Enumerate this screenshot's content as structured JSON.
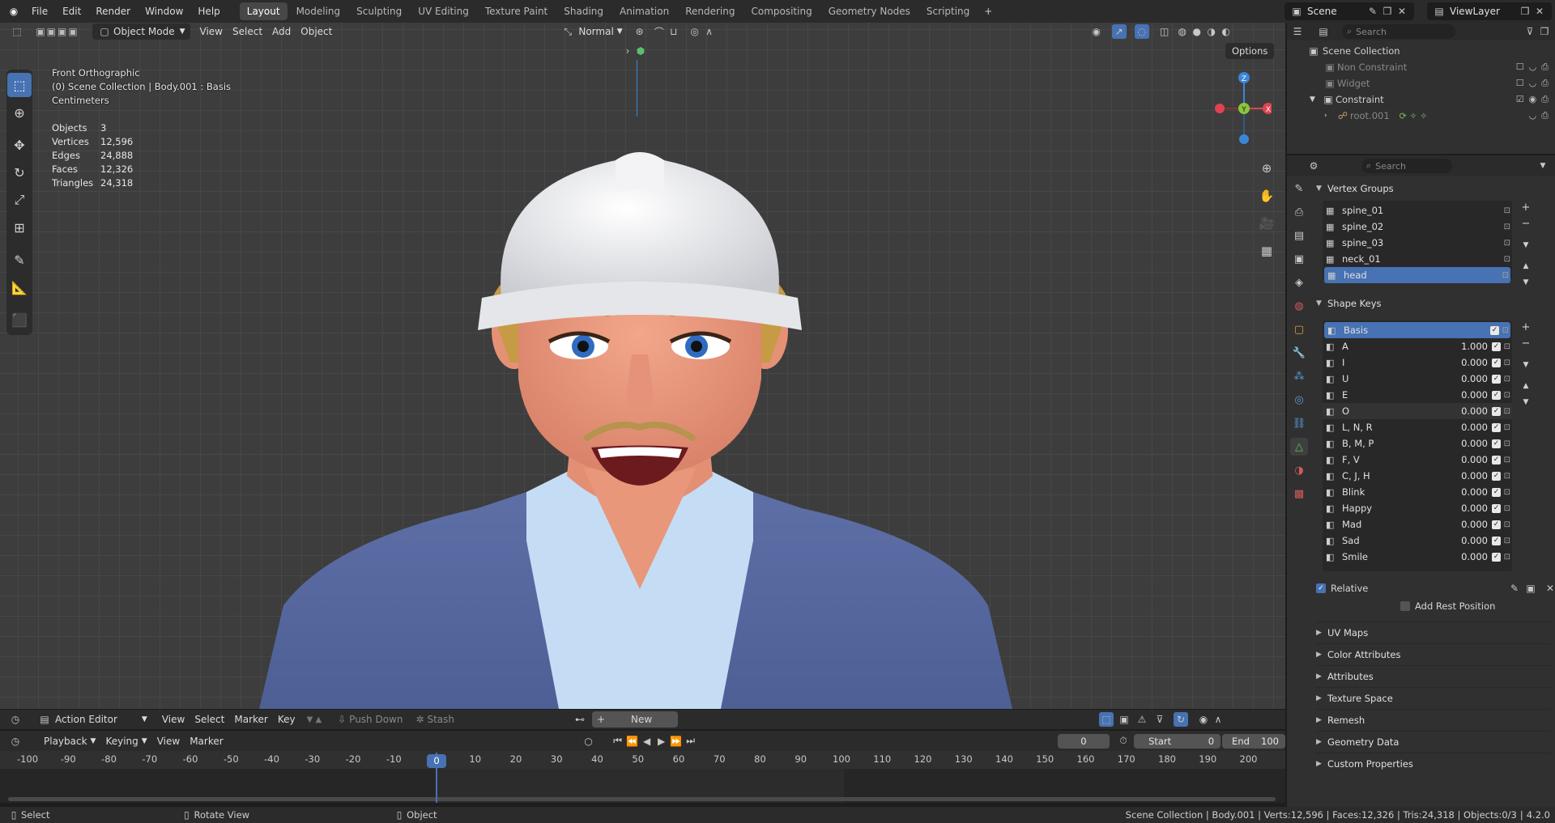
{
  "topbar": {
    "menus": [
      "File",
      "Edit",
      "Render",
      "Window",
      "Help"
    ],
    "workspaces": [
      "Layout",
      "Modeling",
      "Sculpting",
      "UV Editing",
      "Texture Paint",
      "Shading",
      "Animation",
      "Rendering",
      "Compositing",
      "Geometry Nodes",
      "Scripting"
    ],
    "active_workspace": "Layout",
    "scene": "Scene",
    "view_layer": "ViewLayer"
  },
  "viewport": {
    "mode": "Object Mode",
    "menus": [
      "View",
      "Select",
      "Add",
      "Object"
    ],
    "orientation": "Normal",
    "options": "Options",
    "view_name": "Front Orthographic",
    "context": "(0) Scene Collection | Body.001 : Basis",
    "units": "Centimeters",
    "stats": [
      {
        "k": "Objects",
        "v": "3"
      },
      {
        "k": "Vertices",
        "v": "12,596"
      },
      {
        "k": "Edges",
        "v": "24,888"
      },
      {
        "k": "Faces",
        "v": "12,326"
      },
      {
        "k": "Triangles",
        "v": "24,318"
      }
    ],
    "gizmo": {
      "z": "Z",
      "y": "Y",
      "x": "X"
    }
  },
  "outliner": {
    "search_placeholder": "Search",
    "root": "Scene Collection",
    "items": [
      {
        "label": "Non Constraint",
        "dim": true
      },
      {
        "label": "Widget",
        "dim": true
      },
      {
        "label": "Constraint",
        "dim": false
      },
      {
        "label": "root.001",
        "dim": true
      }
    ]
  },
  "properties": {
    "search_placeholder": "Search",
    "vertex_groups_title": "Vertex Groups",
    "vertex_groups": [
      "spine_01",
      "spine_02",
      "spine_03",
      "neck_01",
      "head"
    ],
    "selected_vertex_group": "head",
    "shape_keys_title": "Shape Keys",
    "shape_keys": [
      {
        "name": "Basis",
        "value": ""
      },
      {
        "name": "A",
        "value": "1.000"
      },
      {
        "name": "I",
        "value": "0.000"
      },
      {
        "name": "U",
        "value": "0.000"
      },
      {
        "name": "E",
        "value": "0.000"
      },
      {
        "name": "O",
        "value": "0.000"
      },
      {
        "name": "L, N, R",
        "value": "0.000"
      },
      {
        "name": "B, M, P",
        "value": "0.000"
      },
      {
        "name": "F, V",
        "value": "0.000"
      },
      {
        "name": "C, J, H",
        "value": "0.000"
      },
      {
        "name": "Blink",
        "value": "0.000"
      },
      {
        "name": "Happy",
        "value": "0.000"
      },
      {
        "name": "Mad",
        "value": "0.000"
      },
      {
        "name": "Sad",
        "value": "0.000"
      },
      {
        "name": "Smile",
        "value": "0.000"
      }
    ],
    "relative_label": "Relative",
    "add_rest_label": "Add Rest Position",
    "collapsed_panels": [
      "UV Maps",
      "Color Attributes",
      "Attributes",
      "Texture Space",
      "Remesh",
      "Geometry Data",
      "Custom Properties"
    ]
  },
  "action_editor": {
    "mode": "Action Editor",
    "menus": [
      "View",
      "Select",
      "Marker",
      "Key"
    ],
    "push_down": "Push Down",
    "stash": "Stash",
    "new_label": "New"
  },
  "timeline": {
    "menus": [
      "Playback",
      "Keying",
      "View",
      "Marker"
    ],
    "current_frame": "0",
    "start_label": "Start",
    "start": "0",
    "end_label": "End",
    "end": "100",
    "ticks": [
      "-100",
      "-90",
      "-80",
      "-70",
      "-60",
      "-50",
      "-40",
      "-30",
      "-20",
      "-10",
      "0",
      "10",
      "20",
      "30",
      "40",
      "50",
      "60",
      "70",
      "80",
      "90",
      "100",
      "110",
      "120",
      "130",
      "140",
      "150",
      "160",
      "170",
      "180",
      "190",
      "200"
    ]
  },
  "statusbar": {
    "select": "Select",
    "rotate": "Rotate View",
    "object": "Object",
    "info": "Scene Collection | Body.001 | Verts:12,596 | Faces:12,326 | Tris:24,318 | Objects:0/3",
    "version": "4.2.0"
  },
  "colors": {
    "accent": "#4772b3",
    "x_axis": "#e0434f",
    "y_axis": "#8ac53b",
    "z_axis": "#3b86d6"
  }
}
